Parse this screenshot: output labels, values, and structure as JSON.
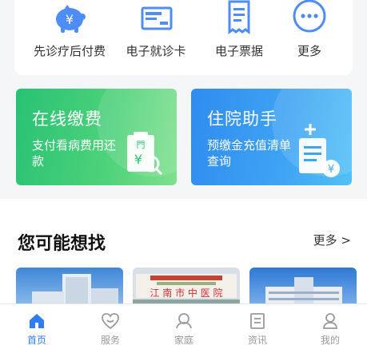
{
  "quick_actions": [
    {
      "label": "先诊疗后付费",
      "icon": "piggy-bank-yuan-icon"
    },
    {
      "label": "电子就诊卡",
      "icon": "medical-card-icon"
    },
    {
      "label": "电子票据",
      "icon": "receipt-icon"
    },
    {
      "label": "更多",
      "icon": "more-dots-icon"
    }
  ],
  "banners": {
    "online_payment": {
      "title": "在线缴费",
      "subtitle": "支付看病费用还款",
      "icon": "payment-clipboard-icon"
    },
    "hospital_assistant": {
      "title": "住院助手",
      "subtitle": "预缴金充值清单查询",
      "icon": "hospital-bill-icon"
    }
  },
  "section": {
    "title": "您可能想找",
    "more": "更多 >",
    "sign_text": "江 南 市 中 医 院"
  },
  "tabbar": [
    {
      "label": "首页",
      "icon": "home-icon",
      "active": true
    },
    {
      "label": "服务",
      "icon": "heart-service-icon",
      "active": false
    },
    {
      "label": "家庭",
      "icon": "family-icon",
      "active": false
    },
    {
      "label": "资讯",
      "icon": "news-icon",
      "active": false
    },
    {
      "label": "我的",
      "icon": "profile-icon",
      "active": false
    }
  ],
  "colors": {
    "accent": "#2f7cf6",
    "green": "#28c274",
    "blue": "#2f8cf0"
  }
}
